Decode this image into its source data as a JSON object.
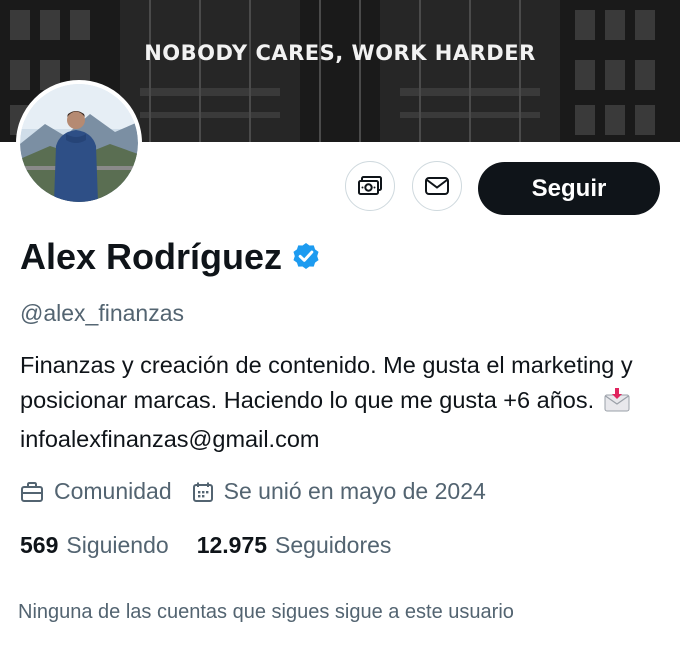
{
  "banner": {
    "text": "NOBODY CARES, WORK HARDER"
  },
  "profile": {
    "name": "Alex Rodríguez",
    "handle": "@alex_finanzas",
    "bio_text": "Finanzas y creación de contenido. Me gusta el marketing y posicionar marcas. Haciendo lo que me gusta +6 años.",
    "bio_email": "infoalexfinanzas@gmail.com",
    "category": "Comunidad",
    "joined": "Se unió en mayo de 2024"
  },
  "actions": {
    "follow_label": "Seguir"
  },
  "stats": {
    "following_count": "569",
    "following_label": "Siguiendo",
    "followers_count": "12.975",
    "followers_label": "Seguidores"
  },
  "followers_you_know": "Ninguna de las cuentas que sigues sigue a este usuario",
  "colors": {
    "text_primary": "#0f1419",
    "text_secondary": "#536471",
    "verified_blue": "#1d9bf0",
    "border": "#cfd9de"
  },
  "icons": {
    "money": "money-icon",
    "message": "envelope-icon",
    "verified": "verified-badge-icon",
    "category": "briefcase-icon",
    "joined": "calendar-icon",
    "email_emoji": "incoming-envelope-emoji"
  }
}
